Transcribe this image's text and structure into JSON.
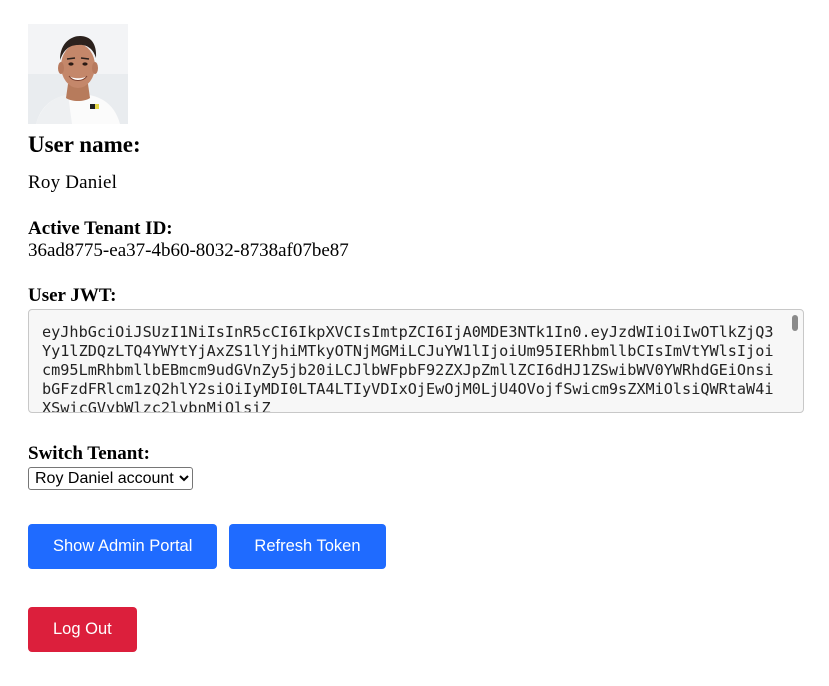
{
  "user": {
    "avatar_alt": "user avatar",
    "name_label": "User name:",
    "name": "Roy Daniel"
  },
  "tenant": {
    "label": "Active Tenant ID:",
    "id": "36ad8775-ea37-4b60-8032-8738af07be87"
  },
  "jwt": {
    "label": "User JWT:",
    "value": "eyJhbGciOiJSUzI1NiIsInR5cCI6IkpXVCIsImtpZCI6IjA0MDE3NTk1In0.eyJzdWIiOiIwOTlkZjQ3Yy1lZDQzLTQ4YWYtYjAxZS1lYjhiMTkyOTNjMGMiLCJuYW1lIjoiUm95IERhbmllbCIsImVtYWlsIjoicm95LmRhbmllbEBmcm9udGVnZy5jb20iLCJlbWFpbF92ZXJpZmllZCI6dHJ1ZSwibWV0YWRhdGEiOnsibGFzdFRlcm1zQ2hlY2siOiIyMDI0LTA4LTIyVDIxOjEwOjM0LjU4OVojfSwicm9sZXMiOlsiQWRtaW4iXSwicGVybWlzc2lvbnMiOlsiZ"
  },
  "switch_tenant": {
    "label": "Switch Tenant:",
    "selected": "Roy Daniel account"
  },
  "buttons": {
    "admin_portal": "Show Admin Portal",
    "refresh_token": "Refresh Token",
    "logout": "Log Out"
  },
  "colors": {
    "primary": "#1f6bff",
    "danger": "#dc1f3c"
  }
}
